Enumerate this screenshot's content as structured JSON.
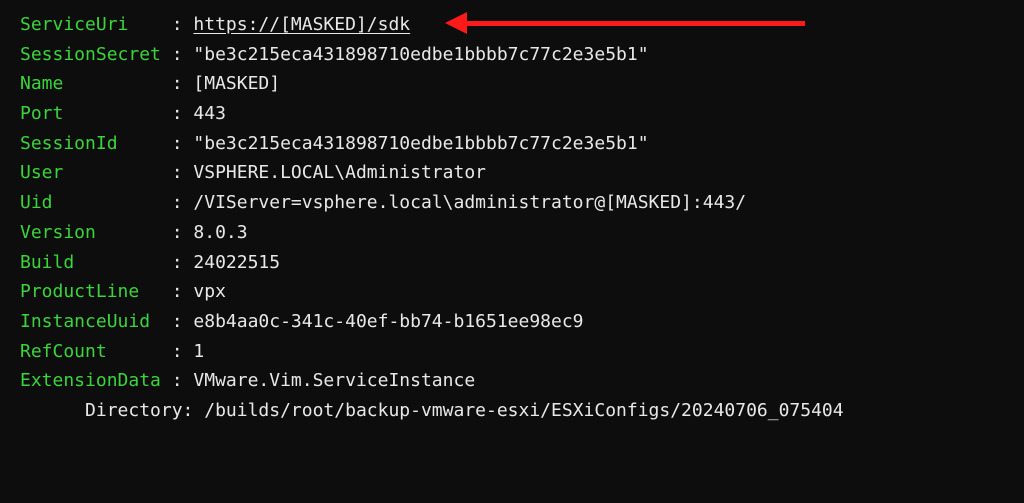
{
  "properties": [
    {
      "key": "ServiceUri",
      "value": "https://[MASKED]/sdk",
      "underlined": true
    },
    {
      "key": "SessionSecret",
      "value": "\"be3c215eca431898710edbe1bbbb7c77c2e3e5b1\""
    },
    {
      "key": "Name",
      "value": "[MASKED]"
    },
    {
      "key": "Port",
      "value": "443"
    },
    {
      "key": "SessionId",
      "value": "\"be3c215eca431898710edbe1bbbb7c77c2e3e5b1\""
    },
    {
      "key": "User",
      "value": "VSPHERE.LOCAL\\Administrator"
    },
    {
      "key": "Uid",
      "value": "/VIServer=vsphere.local\\administrator@[MASKED]:443/"
    },
    {
      "key": "Version",
      "value": "8.0.3"
    },
    {
      "key": "Build",
      "value": "24022515"
    },
    {
      "key": "ProductLine",
      "value": "vpx"
    },
    {
      "key": "InstanceUuid",
      "value": "e8b4aa0c-341c-40ef-bb74-b1651ee98ec9"
    },
    {
      "key": "RefCount",
      "value": "1"
    },
    {
      "key": "ExtensionData",
      "value": "VMware.Vim.ServiceInstance"
    }
  ],
  "directory": {
    "label": "Directory:",
    "path": "/builds/root/backup-vmware-esxi/ESXiConfigs/20240706_075404"
  }
}
